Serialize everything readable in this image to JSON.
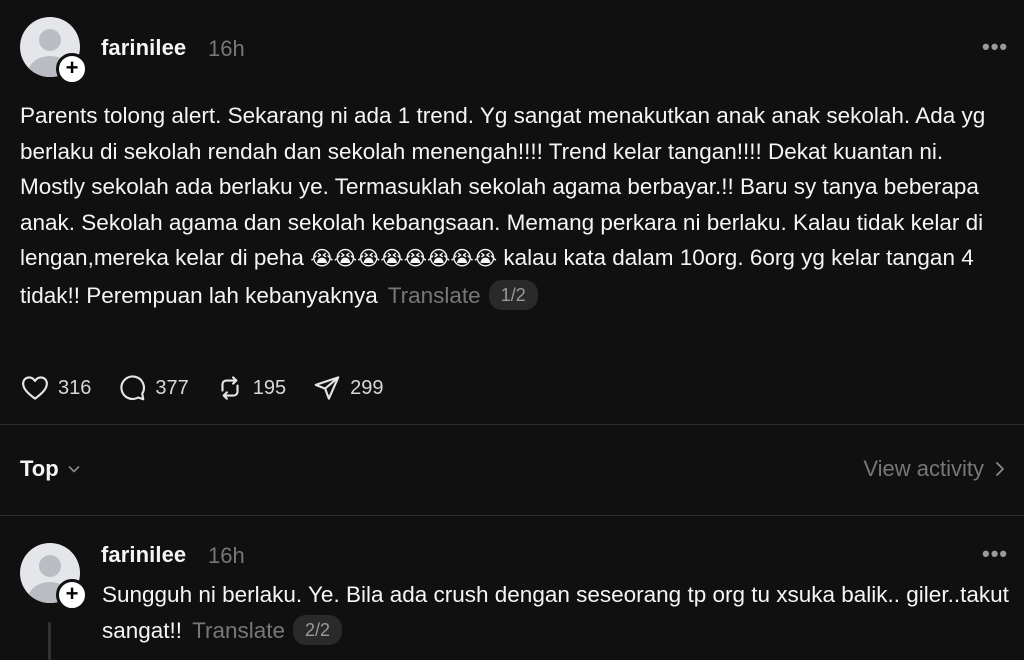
{
  "post": {
    "username": "farinilee",
    "time": "16h",
    "more": "•••",
    "text_main": "Parents tolong alert. Sekarang ni ada 1 trend. Yg sangat menakutkan anak anak sekolah. Ada yg berlaku di sekolah rendah dan sekolah menengah!!!! Trend kelar tangan!!!! Dekat kuantan ni. Mostly sekolah ada berlaku ye. Termasuklah sekolah agama berbayar.!! Baru sy tanya beberapa anak. Sekolah agama dan sekolah kebangsaan. Memang perkara ni berlaku. Kalau tidak kelar di lengan,mereka kelar di peha",
    "emojis": "😭😭😭😭😭😭😭😭",
    "text_tail": "kalau kata dalam 10org. 6org yg kelar tangan 4 tidak!! Perempuan lah kebanyaknya",
    "translate_label": "Translate",
    "page_indicator": "1/2",
    "stats": {
      "likes": "316",
      "replies": "377",
      "reposts": "195",
      "shares": "299"
    }
  },
  "sort": {
    "label": "Top",
    "view_activity": "View activity"
  },
  "reply": {
    "username": "farinilee",
    "time": "16h",
    "more": "•••",
    "text": "Sungguh ni berlaku. Ye. Bila ada crush dengan seseorang tp org tu xsuka balik.. giler..takut sangat!!",
    "translate_label": "Translate",
    "page_indicator": "2/2"
  },
  "colors": {
    "background": "#101010",
    "text_primary": "#f3f5f7",
    "text_secondary": "#777777",
    "divider": "#2c2c2c"
  },
  "icons": [
    "heart-icon",
    "comment-icon",
    "repost-icon",
    "share-icon",
    "chevron-down-icon",
    "chevron-right-icon",
    "more-icon",
    "plus-icon"
  ]
}
